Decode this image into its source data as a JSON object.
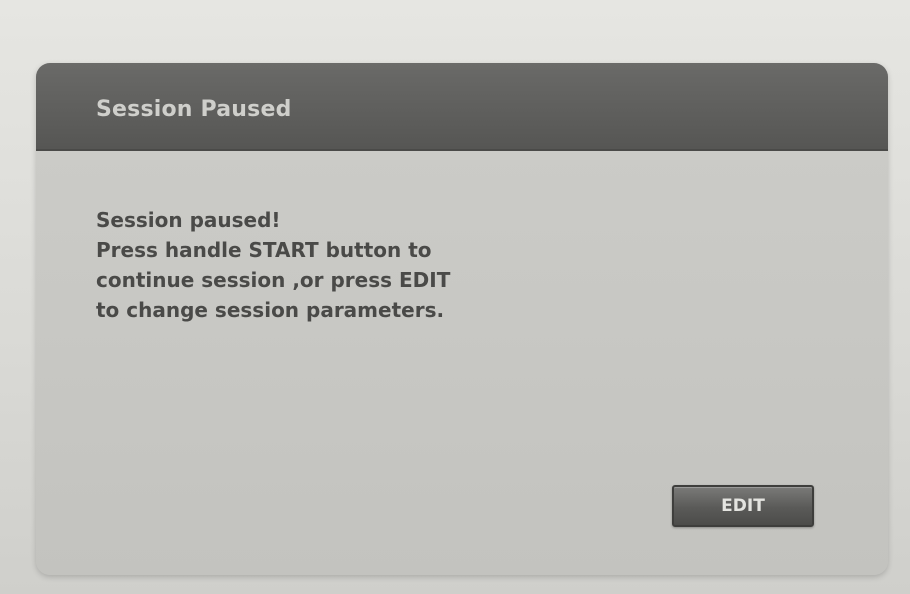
{
  "dialog": {
    "title": "Session Paused",
    "message_lines": [
      "Session paused!",
      "Press handle START button  to",
      "continue session ,or press EDIT",
      "to change session parameters."
    ],
    "edit_button_label": "EDIT"
  },
  "colors": {
    "header_bg": "#5e5e5c",
    "body_bg": "#c6c6c2",
    "button_bg": "#5a5a58",
    "text": "#4a4a48"
  }
}
